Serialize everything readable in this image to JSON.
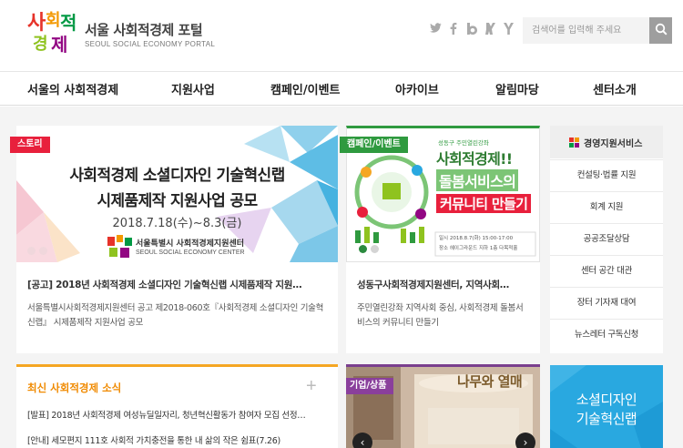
{
  "header": {
    "site_title": "서울 사회적경제 포털",
    "site_subtitle": "SEOUL SOCIAL ECONOMY PORTAL",
    "logo_text": "사회적경제",
    "social_icons": [
      "twitter-icon",
      "facebook-icon",
      "blog-icon",
      "kakaostory-icon",
      "yozm-icon"
    ],
    "search_placeholder": "검색어를 입력해 주세요"
  },
  "nav": {
    "items": [
      "서울의 사회적경제",
      "지원사업",
      "캠페인/이벤트",
      "아카이브",
      "알림마당",
      "센터소개"
    ]
  },
  "cards": {
    "story": {
      "badge": "스토리",
      "img_title_line1": "사회적경제 소셜디자인 기술혁신랩",
      "img_title_line2": "시제품제작 지원사업 공모",
      "img_date": "2018.7.18(수)~8.3(금)",
      "img_org": "서울특별시 사회적경제지원센터",
      "img_org_en": "SEOUL SOCIAL ECONOMY CENTER",
      "title": "[공고] 2018년 사회적경제 소셜디자인 기술혁신랩 시제품제작 지원…",
      "desc": "서울특별시사회적경제지원센터 공고 제2018-060호『사회적경제 소셜디자인 기술혁신랩』 시제품제작 지원사업 공모"
    },
    "campaign": {
      "badge": "캠페인/이벤트",
      "img_kicker": "성동구 주민열린강좌",
      "img_title_line1": "사회적경제!!",
      "img_title_line2": "돌봄서비스의",
      "img_title_line3": "커뮤니티 만들기",
      "img_info": "일시 2018.8.7(화) 15:00-17:00",
      "img_place": "장소 헤이그라운드 지하 1층 다목적홀",
      "title": "성동구사회적경제지원센터, 지역사회…",
      "desc": "주민열린강좌 지역사회 중심, 사회적경제 돌봄서비스의 커뮤니티 만들기"
    }
  },
  "sidebar": {
    "title": "경영지원서비스",
    "items": [
      "컨설팅·법률 지원",
      "회계 지원",
      "공공조달상담",
      "센터 공간 대관",
      "장터 기자재 대여",
      "뉴스레터 구독신청"
    ]
  },
  "news": {
    "title": "최신 사회적경제 소식",
    "items": [
      "[발표] 2018년 사회적경제 여성뉴딜일자리, 청년혁신활동가 참여자 모집 선정…",
      "[안내] 세모편지 111호 사회적 가치충전을 통한 내 삶의 작은 쉼표(7.26)"
    ]
  },
  "corp": {
    "badge": "기업/상품",
    "sign_text": "나무와 열매"
  },
  "banner": {
    "line1": "소셜디자인",
    "line2": "기술혁신랩"
  },
  "colors": {
    "story_badge": "#e8203c",
    "campaign_badge": "#2f9a3f",
    "corp_badge": "#8a3f9c",
    "news_accent": "#f5a623",
    "banner": "#29a8e0"
  }
}
